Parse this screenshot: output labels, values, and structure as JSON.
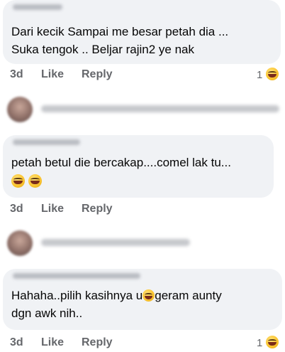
{
  "comments": [
    {
      "text_lines": [
        "Dari kecik Sampai me besar petah dia ...",
        "Suka tengok .. Beljar rajin2 ye nak"
      ],
      "time": "3d",
      "like_label": "Like",
      "reply_label": "Reply",
      "reaction_count": "1"
    },
    {
      "text_lines": [
        "petah betul die bercakap....comel lak tu..."
      ],
      "time": "3d",
      "like_label": "Like",
      "reply_label": "Reply"
    },
    {
      "text_lines": [
        "Hahaha..pilih kasihnya u",
        "geram aunty",
        "dgn awk nih.."
      ],
      "time": "3d",
      "like_label": "Like",
      "reply_label": "Reply",
      "reaction_count": "1"
    }
  ],
  "icons": {
    "emoji": "laughing-emoji-icon",
    "avatar": "avatar"
  },
  "colors": {
    "bubble": "#f0f2f5",
    "text": "#050505",
    "meta": "#65676b"
  }
}
